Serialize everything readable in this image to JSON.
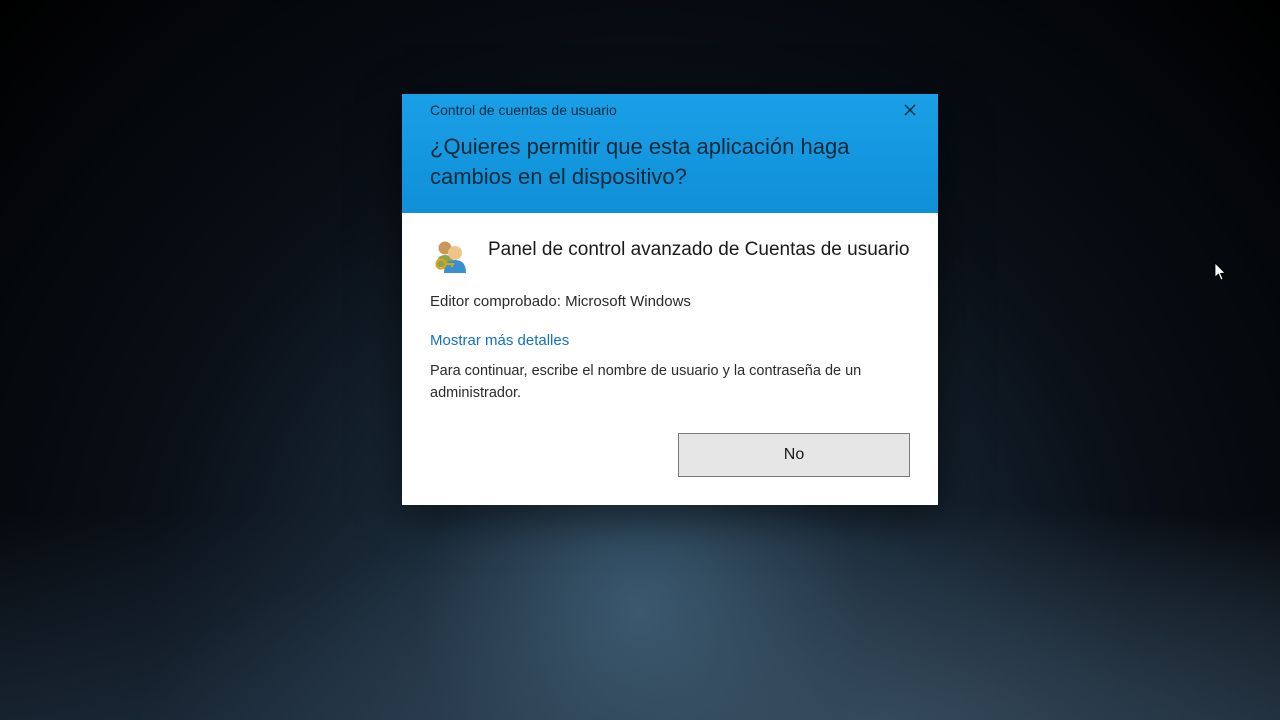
{
  "dialog": {
    "title": "Control de cuentas de usuario",
    "question": "¿Quieres permitir que esta aplicación haga cambios en el dispositivo?",
    "app_name": "Panel de control avanzado de Cuentas de usuario",
    "publisher_line": "Editor comprobado: Microsoft Windows",
    "details_link": "Mostrar más detalles",
    "instruction": "Para continuar, escribe el nombre de usuario y la contraseña de un administrador.",
    "no_button": "No"
  }
}
